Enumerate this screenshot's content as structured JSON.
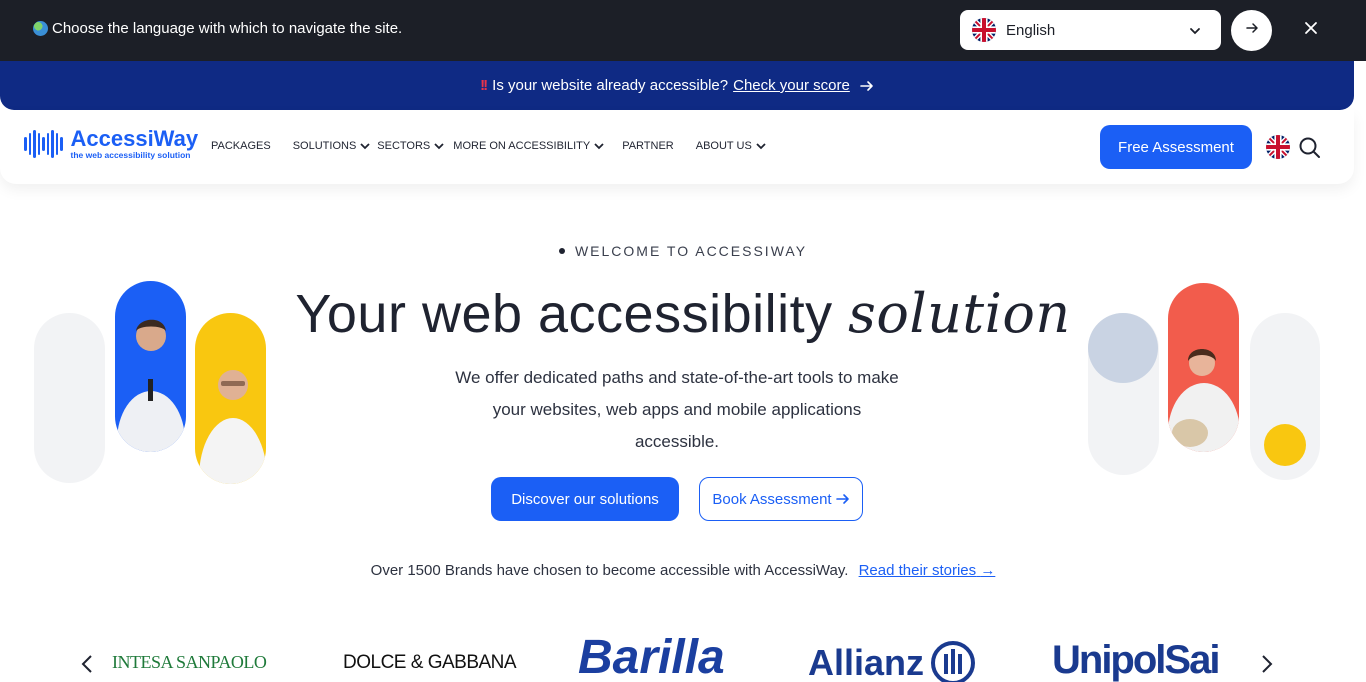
{
  "language_bar": {
    "message": "Choose the language with which to navigate the site.",
    "selected_language": "English"
  },
  "promo": {
    "text": "Is your website already accessible?",
    "link": "Check your score"
  },
  "nav": {
    "logo_name": "AccessiWay",
    "logo_tagline": "the web accessibility solution",
    "items": [
      {
        "label": "PACKAGES",
        "dropdown": false
      },
      {
        "label": "SOLUTIONS",
        "dropdown": true
      },
      {
        "label": "SECTORS",
        "dropdown": true
      },
      {
        "label": "MORE ON ACCESSIBILITY",
        "dropdown": true
      },
      {
        "label": "PARTNER",
        "dropdown": false
      },
      {
        "label": "ABOUT US",
        "dropdown": true
      }
    ],
    "cta": "Free Assessment"
  },
  "hero": {
    "eyebrow": "WELCOME TO ACCESSIWAY",
    "title_main": "Your web accessibility ",
    "title_italic": "solution",
    "subtitle": "We offer dedicated paths and state-of-the-art tools to make your websites, web apps and mobile applications accessible.",
    "primary_button": "Discover our solutions",
    "secondary_button": "Book Assessment",
    "brands_text": "Over 1500 Brands have chosen to become accessible with AccessiWay.",
    "brands_link": "Read their stories"
  },
  "logos": [
    "INTESA SANPAOLO",
    "DOLCE & GABBANA",
    "Barilla",
    "Allianz",
    "UnipolSai"
  ],
  "colors": {
    "brand_blue": "#1b5ff5",
    "promo_navy": "#0f2a84",
    "langbar_dark": "#1c1f27",
    "yellow": "#f9c710",
    "coral": "#f25c4c"
  }
}
